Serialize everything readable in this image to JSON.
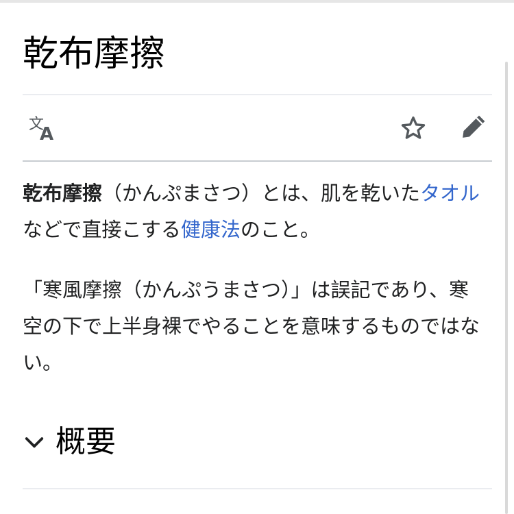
{
  "page": {
    "title": "乾布摩擦"
  },
  "toolbar": {
    "language_icon": "translate-icon",
    "watch_icon": "star-icon",
    "edit_icon": "pencil-icon"
  },
  "article": {
    "p1": {
      "term": "乾布摩擦",
      "text1": "（かんぷまさつ）とは、肌を乾いた",
      "link1": "タオル",
      "text2": "などで直接こする",
      "link2": "健康法",
      "text3": "のこと。"
    },
    "p2": {
      "text": "「寒風摩擦（かんぷうまさつ）」は誤記であり、寒空の下で上半身裸でやることを意味するものではない。"
    }
  },
  "section": {
    "icon": "chevron-down-icon",
    "title": "概要"
  },
  "colors": {
    "link": "#3366cc",
    "text": "#202122",
    "icon": "#54595d",
    "divider": "#eaecf0"
  }
}
